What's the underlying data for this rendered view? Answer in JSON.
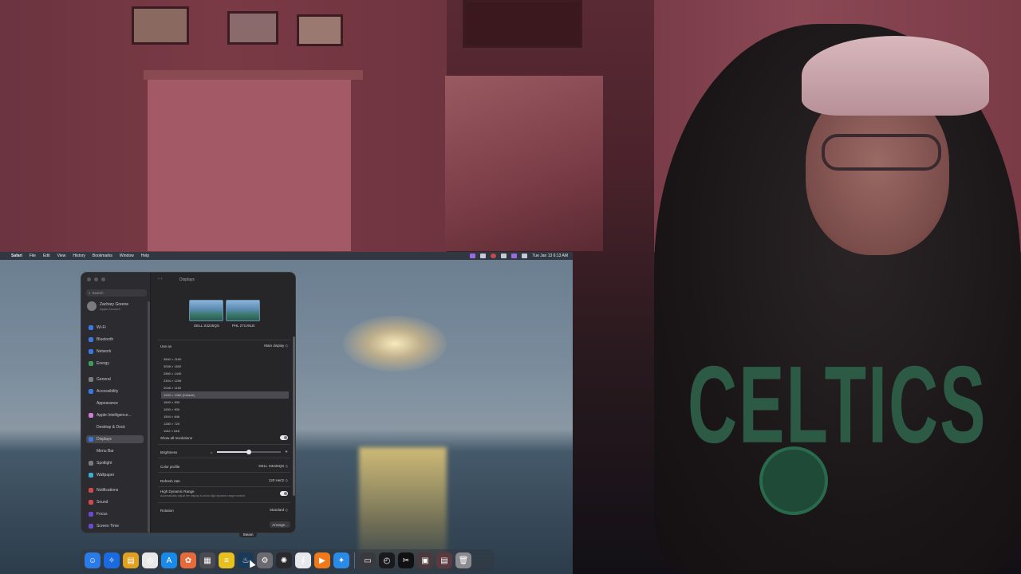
{
  "menubar": {
    "app": "Safari",
    "menus": [
      "File",
      "Edit",
      "View",
      "History",
      "Bookmarks",
      "Window",
      "Help"
    ],
    "clock": "Tue Jan 13  6:13 AM"
  },
  "window": {
    "title": "Displays",
    "search_placeholder": "Search",
    "user": {
      "name": "Zachary Greene",
      "subtitle": "Apple Account"
    },
    "sidebar": [
      {
        "label": "Wi-Fi",
        "color": "#3a7ae0"
      },
      {
        "label": "Bluetooth",
        "color": "#3a7ae0"
      },
      {
        "label": "Network",
        "color": "#3a7ae0"
      },
      {
        "label": "Energy",
        "color": "#3aa05a"
      },
      {
        "label": "General",
        "color": "#7a7a80"
      },
      {
        "label": "Accessibility",
        "color": "#3a7ae0"
      },
      {
        "label": "Appearance",
        "color": "#2a2a2e"
      },
      {
        "label": "Apple Intelligence...",
        "color": "#d07ad0"
      },
      {
        "label": "Desktop & Dock",
        "color": "#2a2a2e"
      },
      {
        "label": "Displays",
        "color": "#3a7ae0"
      },
      {
        "label": "Menu Bar",
        "color": "#2a2a2e"
      },
      {
        "label": "Spotlight",
        "color": "#7a7a80"
      },
      {
        "label": "Wallpaper",
        "color": "#3ab0d0"
      },
      {
        "label": "Notifications",
        "color": "#d04a4a"
      },
      {
        "label": "Sound",
        "color": "#d04a4a"
      },
      {
        "label": "Focus",
        "color": "#6a4ad0"
      },
      {
        "label": "Screen Time",
        "color": "#6a4ad0"
      }
    ],
    "displays": [
      {
        "name": "DELL S3225QS"
      },
      {
        "name": "PHL 271V8LB"
      }
    ],
    "use_as": {
      "label": "Use as",
      "value": "Main display"
    },
    "resolutions": [
      "3840 × 2160",
      "3008 × 1692",
      "2560 × 1440",
      "2304 × 1296",
      "2048 × 1152",
      "1920 × 1080 (Default)",
      "1600 × 900",
      "1600 × 900",
      "1504 × 846",
      "1280 × 720",
      "1152 × 648"
    ],
    "selected_resolution_index": 5,
    "show_all_resolutions": "Show all resolutions",
    "brightness": {
      "label": "Brightness",
      "level": 0.5
    },
    "color_profile": {
      "label": "Color profile",
      "value": "DELL S3225QS"
    },
    "refresh_rate": {
      "label": "Refresh rate",
      "value": "120 Hertz"
    },
    "hdr": {
      "label": "High Dynamic Range",
      "desc": "Automatically adjust the display to show high dynamic range content."
    },
    "rotation": {
      "label": "Rotation",
      "value": "Standard"
    },
    "arrange_button": "Arrange..."
  },
  "dock": {
    "tooltip": "Steam",
    "apps": [
      {
        "name": "finder-icon",
        "color": "#2a7ae8",
        "glyph": "☺"
      },
      {
        "name": "bluesky-icon",
        "color": "#1a6ae0",
        "glyph": "✧"
      },
      {
        "name": "folder-icon",
        "color": "#e0a020",
        "glyph": "▤"
      },
      {
        "name": "chrome-icon",
        "color": "#e8e8e8",
        "glyph": "◎"
      },
      {
        "name": "app-store-icon",
        "color": "#1a8ae8",
        "glyph": "A"
      },
      {
        "name": "photos-icon",
        "color": "#e86a3a",
        "glyph": "✿"
      },
      {
        "name": "launchpad-icon",
        "color": "#4a4a50",
        "glyph": "▦"
      },
      {
        "name": "notes-icon",
        "color": "#e8c020",
        "glyph": "≡"
      },
      {
        "name": "steam-icon",
        "color": "#1a3a5a",
        "glyph": "♨"
      },
      {
        "name": "settings-icon",
        "color": "#6a6a70",
        "glyph": "⚙"
      },
      {
        "name": "chatgpt-icon",
        "color": "#2a2a2e",
        "glyph": "✺"
      },
      {
        "name": "scrobbler-icon",
        "color": "#e8e8ec",
        "glyph": "∮"
      },
      {
        "name": "vlc-icon",
        "color": "#f07a1a",
        "glyph": "▶"
      },
      {
        "name": "safari-icon",
        "color": "#2a8ae8",
        "glyph": "✦"
      }
    ],
    "recents": [
      {
        "name": "window-thumb-icon",
        "color": "#3a3a3e",
        "glyph": "▭"
      },
      {
        "name": "activity-monitor-icon",
        "color": "#1a1a1e",
        "glyph": "◴"
      },
      {
        "name": "capcut-icon",
        "color": "#111114",
        "glyph": "✂"
      },
      {
        "name": "screenshot-icon",
        "color": "#4a3a3e",
        "glyph": "▣"
      },
      {
        "name": "window-thumb-icon",
        "color": "#5a3a3e",
        "glyph": "▤"
      },
      {
        "name": "trash-icon",
        "color": "#8a8a90",
        "glyph": "🗑"
      }
    ]
  }
}
